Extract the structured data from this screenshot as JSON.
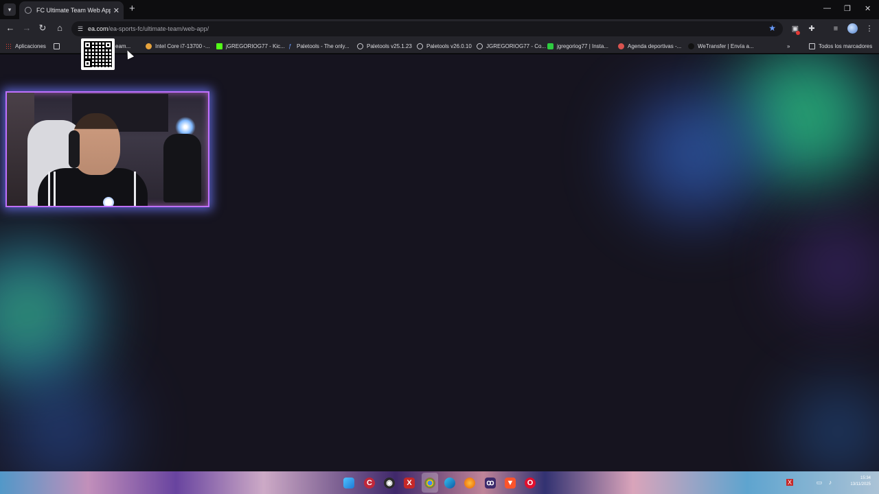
{
  "browser": {
    "tab": {
      "title": "FC Ultimate Team Web App - EA"
    },
    "address": {
      "host": "ea.com",
      "path": "/ea-sports-fc/ultimate-team/web-app/"
    },
    "bookmarks": [
      {
        "label": "Aplicaciones",
        "icon": "apps-grid-icon"
      },
      {
        "label": "eam...",
        "icon": "ea-icon"
      },
      {
        "label": "Intel Core i7-13700 -...",
        "icon": "intel-icon"
      },
      {
        "label": "jGREGORIOG77 - Kic...",
        "icon": "kick-icon"
      },
      {
        "label": "Paletools - The only...",
        "icon": "paletools-icon"
      },
      {
        "label": "Paletools v25.1.23",
        "icon": "globe-icon"
      },
      {
        "label": "Paletools v26.0.10",
        "icon": "globe-icon"
      },
      {
        "label": "JGREGORIOG77 - Co...",
        "icon": "globe-icon"
      },
      {
        "label": "jgregoriog77 | Insta...",
        "icon": "instagram-icon"
      },
      {
        "label": "Agenda deportivas -...",
        "icon": "pin-icon"
      },
      {
        "label": "WeTransfer | Envía a...",
        "icon": "wetransfer-icon"
      }
    ],
    "all_bookmarks": "Todos los marcadores"
  },
  "colors": {
    "page_bg": "#16141f",
    "accent_star": "#6a9cff",
    "webcam_border": "#c070ff"
  },
  "taskbar": {
    "apps": [
      "windows-start-icon",
      "crunchyroll-icon",
      "obs-icon",
      "xmind-icon",
      "chrome-icon",
      "edge-icon",
      "firefox-icon",
      "app-icon",
      "brave-icon",
      "opera-icon"
    ],
    "tray_icons": [
      "xmind-tray-icon",
      "network-icon",
      "speaker-icon"
    ],
    "time": "15:34",
    "date": "13/11/2025"
  }
}
